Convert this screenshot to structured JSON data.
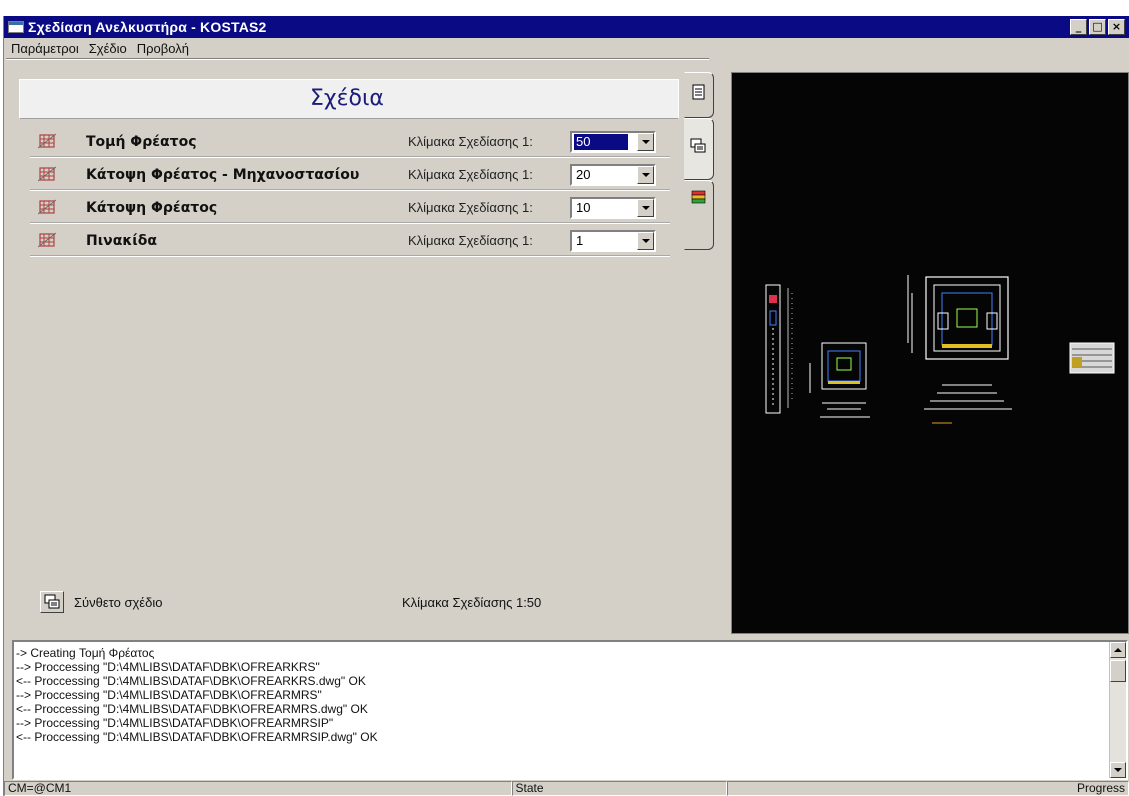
{
  "window": {
    "title": "Σχεδίαση Ανελκυστήρα - KOSTAS2",
    "controls": {
      "minimize": "_",
      "maximize": "□",
      "close": "×"
    }
  },
  "menu": [
    "Παράμετροι",
    "Σχέδιο",
    "Προβολή"
  ],
  "panel": {
    "title": "Σχέδια",
    "rows": [
      {
        "name": "Τομή Φρέατος",
        "scale_label": "Κλίμακα Σχεδίασης 1:",
        "scale_value": "50",
        "selected": true
      },
      {
        "name": "Κάτοψη Φρέατος - Μηχανοστασίου",
        "scale_label": "Κλίμακα Σχεδίασης 1:",
        "scale_value": "20",
        "selected": false
      },
      {
        "name": "Κάτοψη Φρέατος",
        "scale_label": "Κλίμακα Σχεδίασης 1:",
        "scale_value": "10",
        "selected": false
      },
      {
        "name": "Πινακίδα",
        "scale_label": "Κλίμακα Σχεδίασης 1:",
        "scale_value": "1",
        "selected": false
      }
    ],
    "composite_label": "Σύνθετο σχέδιο",
    "composite_scale": "Κλίμακα Σχεδίασης 1:50"
  },
  "log": [
    "-> Creating Τομή Φρέατος",
    "--> Proccessing \"D:\\4M\\LIBS\\DATAF\\DBK\\OFREARKRS\"",
    "<-- Proccessing \"D:\\4M\\LIBS\\DATAF\\DBK\\OFREARKRS.dwg\" OK",
    "--> Proccessing \"D:\\4M\\LIBS\\DATAF\\DBK\\OFREARMRS\"",
    "<-- Proccessing \"D:\\4M\\LIBS\\DATAF\\DBK\\OFREARMRS.dwg\" OK",
    "--> Proccessing \"D:\\4M\\LIBS\\DATAF\\DBK\\OFREARMRSIP\"",
    "<-- Proccessing \"D:\\4M\\LIBS\\DATAF\\DBK\\OFREARMRSIP.dwg\" OK"
  ],
  "status": {
    "left": "CM=@CM1",
    "middle": "State",
    "right": "Progress"
  },
  "icons": {
    "row": "layers-grid-icon",
    "composite": "composite-drawing-icon",
    "tabs": [
      "document-icon",
      "composite-drawing-icon",
      "layers-icon"
    ]
  },
  "colors": {
    "title_bar": "#0a0a84",
    "panel_title": "#1b1b7a",
    "preview_bg": "#050505",
    "selection": "#0a0a84"
  }
}
